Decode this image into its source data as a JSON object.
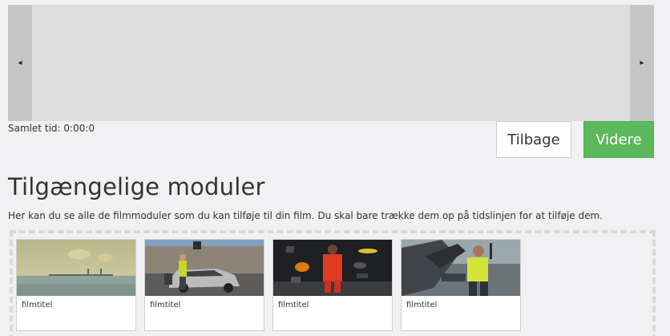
{
  "timeline": {
    "left_arrow": "◂",
    "right_arrow": "▸",
    "total_time": "Samlet tid: 0:00:0"
  },
  "nav": {
    "back_label": "Tilbage",
    "next_label": "Videre"
  },
  "modules_section": {
    "heading": "Tilgængelige moduler",
    "description": "Her kan du se alle de filmmoduler som du kan tilføje til din film. Du skal bare trække dem op på tidslinjen for at tilføje dem.",
    "modules": [
      {
        "title": "filmtitel"
      },
      {
        "title": "filmtitel"
      },
      {
        "title": "filmtitel"
      },
      {
        "title": "filmtitel"
      }
    ]
  },
  "colors": {
    "primary_button": "#5cb85c",
    "timeline_bg": "#dedede",
    "page_bg": "#f1f1f3"
  }
}
